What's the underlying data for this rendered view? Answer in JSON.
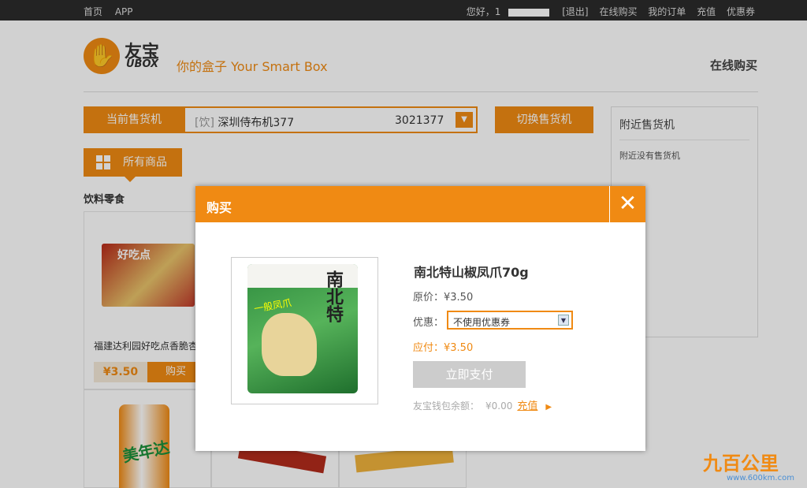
{
  "topbar": {
    "left": [
      "首页",
      "APP"
    ],
    "greeting": "您好，1",
    "links": [
      "[退出]",
      "在线购买",
      "我的订单",
      "充值",
      "优惠券"
    ]
  },
  "header": {
    "logo_cn": "友宝",
    "logo_en": "UBOX",
    "tagline": "你的盒子 Your Smart Box",
    "section_title": "在线购买"
  },
  "machine": {
    "current_label": "当前售货机",
    "tag": "[饮]",
    "name": "深圳侍布机377",
    "code": "3021377",
    "switch_label": "切换售货机"
  },
  "nearby": {
    "title": "附近售货机",
    "empty": "附近没有售货机"
  },
  "catalog": {
    "all_tab": "所有商品",
    "category": "饮料零食",
    "product": {
      "img_text": "好吃点",
      "name": "福建达利园好吃点香脆杏",
      "price": "¥3.50",
      "buy_label": "购买"
    },
    "can_text": "美年达"
  },
  "modal": {
    "title": "购买",
    "close": "✕",
    "pack_title": "南北特",
    "pack_sub": "一般凤爪",
    "product_name": "南北特山椒凤爪70g",
    "original_price": "原价：¥3.50",
    "discount_label": "优惠：",
    "discount_value": "不使用优惠券",
    "due": "应付：¥3.50",
    "pay_label": "立即支付",
    "wallet_label": "友宝钱包余额：",
    "wallet_amount": "¥0.00",
    "recharge": "充值"
  },
  "watermark": {
    "cn": "九百公里",
    "url": "www.600km.com"
  },
  "colors": {
    "accent": "#f08a13",
    "topbar": "#2b2b2b"
  }
}
